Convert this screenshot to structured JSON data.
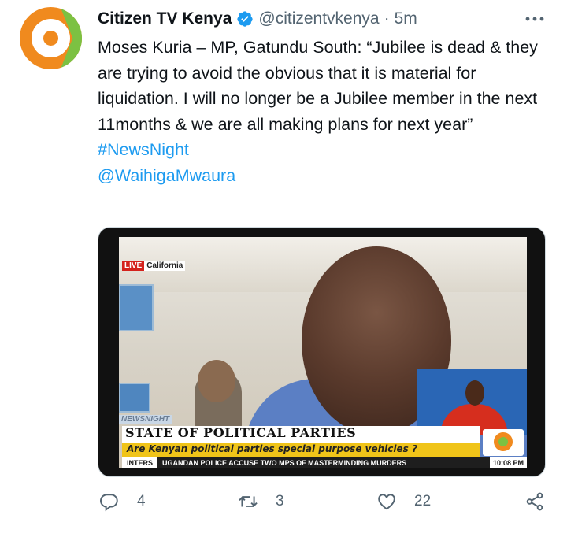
{
  "tweet": {
    "author_name": "Citizen TV Kenya",
    "handle": "@citizentvkenya",
    "separator": "·",
    "time": "5m",
    "body": "Moses Kuria – MP, Gatundu South: “Jubilee is dead & they are trying to avoid the obvious that it is material for liquidation. I will no longer be a Jubilee member in the next 11months & we are all making plans for next year”",
    "hashtag": "#NewsNight",
    "mention": "@WaihigaMwaura"
  },
  "media": {
    "live_label": "LIVE",
    "location": "California",
    "show_tag": "NEWSNIGHT",
    "headline": "STATE OF POLITICAL PARTIES",
    "subheadline": "Are Kenyan political parties special purpose vehicles ?",
    "ticker_label": "INTERS",
    "ticker_text": "UGANDAN POLICE ACCUSE TWO MPS OF MASTERMINDING MURDERS",
    "clock": "10:08 PM"
  },
  "actions": {
    "replies": "4",
    "retweets": "3",
    "likes": "22"
  },
  "colors": {
    "accent": "#1d9bf0",
    "secondary_text": "#536471",
    "brand_orange": "#f08a1e",
    "brand_green": "#7cc142"
  },
  "icons": [
    "verified-badge-icon",
    "more-icon",
    "reply-icon",
    "retweet-icon",
    "like-icon",
    "share-icon"
  ]
}
